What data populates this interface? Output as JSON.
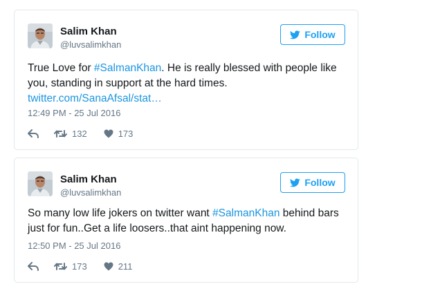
{
  "accent_color": "#1da1f2",
  "link_color": "#1b95e0",
  "tweets": [
    {
      "name": "Salim Khan",
      "handle": "@luvsalimkhan",
      "follow_label": "Follow",
      "text_prefix": "True Love for ",
      "hashtag": "#SalmanKhan",
      "text_suffix": ". He is really blessed with people like you, standing in support at the hard times.",
      "url": "twitter.com/SanaAfsal/stat…",
      "timestamp": "12:49 PM - 25 Jul 2016",
      "retweets": "132",
      "likes": "173"
    },
    {
      "name": "Salim Khan",
      "handle": "@luvsalimkhan",
      "follow_label": "Follow",
      "text_prefix": "So many low life jokers on twitter want ",
      "hashtag": "#SalmanKhan",
      "text_suffix": " behind bars just for fun..Get a life loosers..that aint happening now.",
      "timestamp": "12:50 PM - 25 Jul 2016",
      "retweets": "173",
      "likes": "211"
    }
  ]
}
